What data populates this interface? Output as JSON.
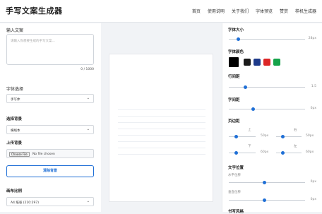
{
  "header": {
    "title": "手写文案生成器",
    "nav": [
      "首页",
      "使用说明",
      "关于我们",
      "字体预览",
      "赞赏",
      "样机生成器"
    ]
  },
  "left": {
    "input_label": "输入文案",
    "input_placeholder": "请输入你想要生成的手写文案…",
    "char_count": "0 / 1000",
    "font_label": "字体选择",
    "font_value": "手写体",
    "bg_label": "选择背景",
    "bg_value": "横线本",
    "upload_label": "上传背景",
    "choose_file_button": "Choose File",
    "no_file_text": "No file chosen",
    "clear_bg_button": "清除背景",
    "ratio_label": "画布比例",
    "ratio_value": "A4 纸张 (210:297)"
  },
  "right": {
    "font_size_label": "字体大小",
    "font_size_value": "28px",
    "font_size_level": 0.1,
    "font_color_label": "字体颜色",
    "colors": [
      "#000000",
      "#1a1a1a",
      "#1e3a8a",
      "#dc2626",
      "#16a34a"
    ],
    "line_height_label": "行间距",
    "line_height_value": "1.5",
    "line_height_level": 0.25,
    "letter_spacing_label": "字间距",
    "letter_spacing_value": "0px",
    "letter_spacing_level": 0.35,
    "margin_label": "页边距",
    "margin_top_label": "上",
    "margin_top_value": "50px",
    "margin_right_label": "右",
    "margin_right_value": "50px",
    "margin_bottom_label": "下",
    "margin_bottom_value": "60px",
    "margin_left_label": "左",
    "margin_left_value": "60px",
    "text_pos_label": "文字位置",
    "h_offset_label": "水平位移",
    "h_offset_value": "0px",
    "v_offset_label": "垂直位移",
    "v_offset_value": "0px",
    "effect_label": "书写风格"
  }
}
